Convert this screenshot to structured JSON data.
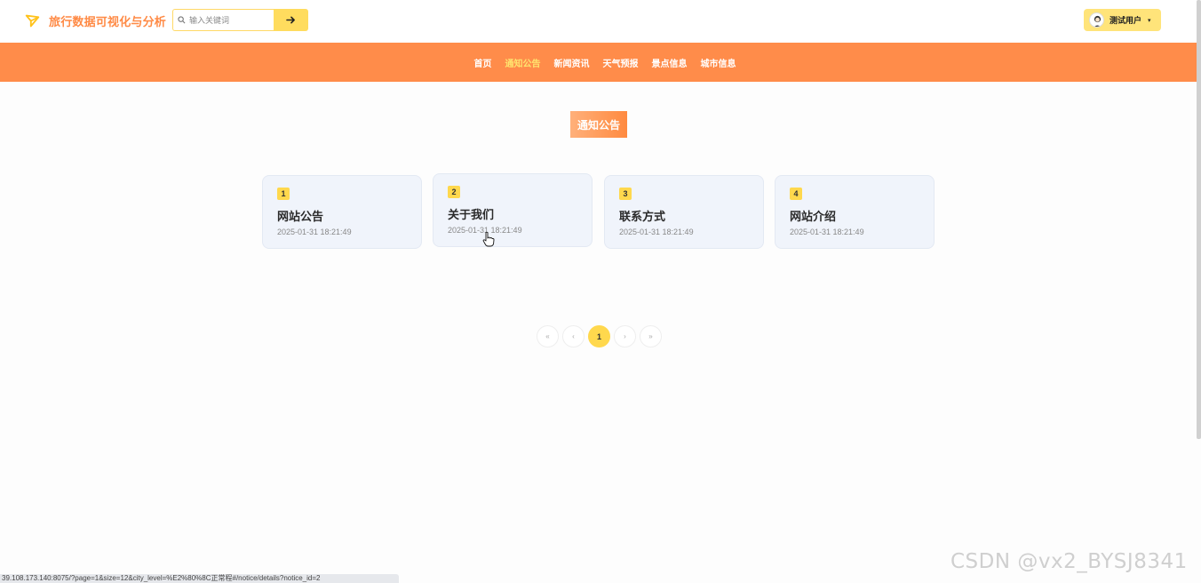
{
  "header": {
    "site_title": "旅行数据可视化与分析",
    "search": {
      "placeholder": "输入关键词",
      "value": ""
    },
    "user": {
      "name": "测试用户"
    }
  },
  "nav": {
    "items": [
      {
        "label": "首页",
        "active": false
      },
      {
        "label": "通知公告",
        "active": true
      },
      {
        "label": "新闻资讯",
        "active": false
      },
      {
        "label": "天气预报",
        "active": false
      },
      {
        "label": "景点信息",
        "active": false
      },
      {
        "label": "城市信息",
        "active": false
      }
    ]
  },
  "main": {
    "section_title": "通知公告",
    "cards": [
      {
        "num": "1",
        "title": "网站公告",
        "date": "2025-01-31 18:21:49"
      },
      {
        "num": "2",
        "title": "关于我们",
        "date": "2025-01-31 18:21:49"
      },
      {
        "num": "3",
        "title": "联系方式",
        "date": "2025-01-31 18:21:49"
      },
      {
        "num": "4",
        "title": "网站介绍",
        "date": "2025-01-31 18:21:49"
      }
    ]
  },
  "pagination": {
    "first": "«",
    "prev": "‹",
    "current": "1",
    "next": "›",
    "last": "»"
  },
  "status_bar": {
    "url": "39.108.173.140:8075/?page=1&size=12&city_level=%E2%80%8C正常程#/notice/details?notice_id=2"
  },
  "watermark": "CSDN @vx2_BYSJ8341",
  "colors": {
    "accent_orange": "#ff8c4a",
    "accent_yellow": "#ffd84d",
    "active_nav": "#ffe46e"
  }
}
